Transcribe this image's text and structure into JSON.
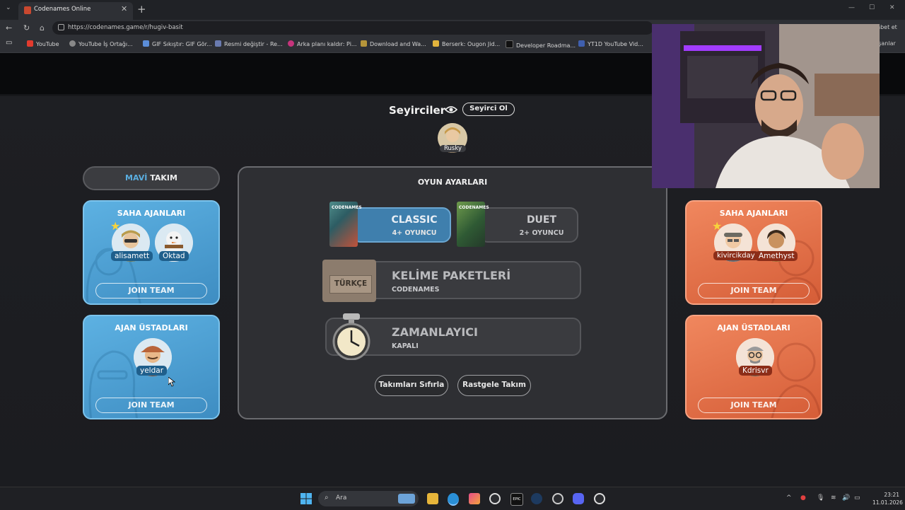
{
  "browser": {
    "tab_title": "Codenames Online",
    "url": "https://codenames.game/r/hugiv-basit",
    "sidebar_label_right": "hbet et",
    "bookmarks_more": "ışanlar",
    "bookmarks": [
      {
        "label": "YouTube",
        "color": "#e33b2e"
      },
      {
        "label": "YouTube İş Ortağı...",
        "color": "#888888"
      },
      {
        "label": "GIF Sıkıştır: GIF Gör...",
        "color": "#5b8dd8"
      },
      {
        "label": "Resmi değiştir - Re...",
        "color": "#6a7bb0"
      },
      {
        "label": "Arka planı kaldır: Pi...",
        "color": "#c6347c"
      },
      {
        "label": "Download and Wa...",
        "color": "#b5953a"
      },
      {
        "label": "Berserk: Ougon Jid...",
        "color": "#e2b43d"
      },
      {
        "label": "Developer Roadma...",
        "color": "#222222"
      },
      {
        "label": "YT1D YouTube Vid...",
        "color": "#3f5fae"
      }
    ]
  },
  "spectators": {
    "title": "Seyirciler",
    "button": "Seyirci Ol",
    "members": [
      "Rusky"
    ]
  },
  "blue_team": {
    "header_word1": "MAVİ",
    "header_word2": "TAKIM",
    "operatives_title": "SAHA AJANLARI",
    "operatives": [
      "alisamett",
      "Oktad"
    ],
    "spymasters_title": "AJAN ÜSTADLARI",
    "spymasters": [
      "yeldar"
    ],
    "join_label": "JOIN TEAM"
  },
  "red_team": {
    "operatives_title": "SAHA AJANLARI",
    "operatives": [
      "kivircikday",
      "Amethyst"
    ],
    "spymasters_title": "AJAN ÜSTADLARI",
    "spymasters": [
      "Kdrisvr"
    ],
    "join_label": "JOIN TEAM"
  },
  "settings": {
    "title": "OYUN AYARLARI",
    "modes": [
      {
        "name": "CLASSIC",
        "sub": "4+ OYUNCU",
        "selected": true
      },
      {
        "name": "DUET",
        "sub": "2+ OYUNCU",
        "selected": false
      }
    ],
    "word_packs": {
      "title": "KELİME PAKETLERİ",
      "sub": "CODENAMES",
      "badge": "TÜRKÇE"
    },
    "timer": {
      "title": "ZAMANLAYICI",
      "sub": "KAPALI"
    },
    "reset_button": "Takımları Sıfırla",
    "random_button": "Rastgele Takım"
  },
  "taskbar": {
    "search_placeholder": "Ara",
    "time": "23:21",
    "date": "11.01.2026"
  },
  "colors": {
    "blue": "#4a9fd6",
    "red": "#e8724a",
    "accent_blue": "#5aaee0"
  }
}
